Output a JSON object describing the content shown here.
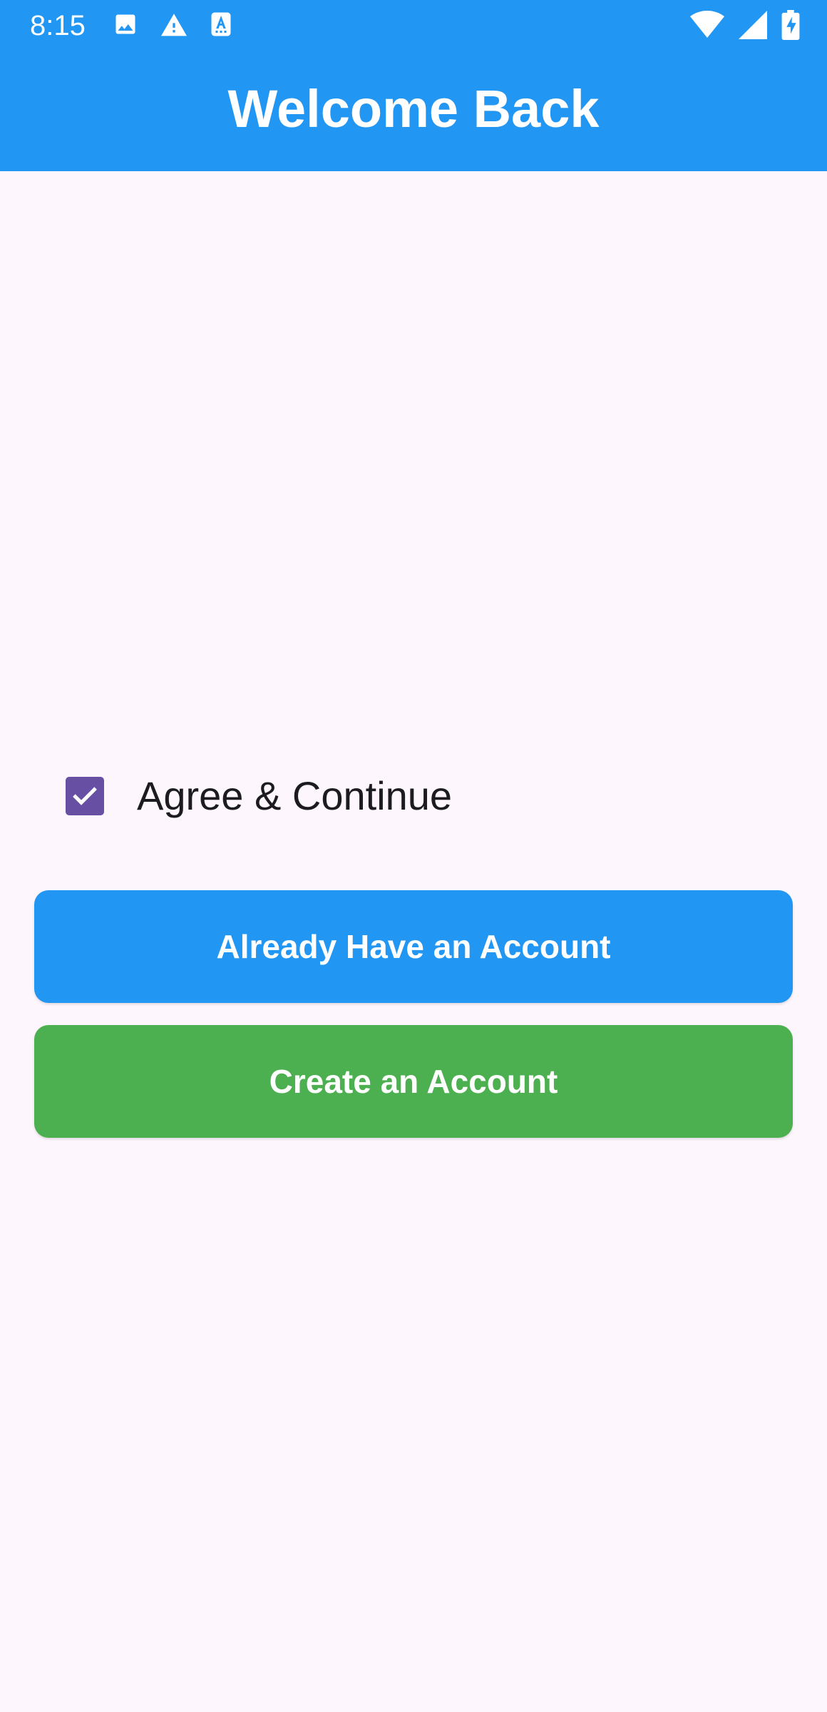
{
  "status_bar": {
    "time": "8:15",
    "left_icons": [
      "image-icon",
      "warning-icon",
      "text-a-icon"
    ],
    "right_icons": [
      "wifi-icon",
      "cellular-signal-icon",
      "battery-charging-icon"
    ]
  },
  "app_bar": {
    "title": "Welcome Back",
    "color": "#2196F3"
  },
  "agreement": {
    "label": "Agree & Continue",
    "checked": true,
    "checkbox_color": "#6750A4"
  },
  "buttons": {
    "login_label": "Already Have an Account",
    "login_color": "#2196F3",
    "create_label": "Create an Account",
    "create_color": "#4CAF50"
  },
  "colors": {
    "background": "#FDF6FD"
  }
}
